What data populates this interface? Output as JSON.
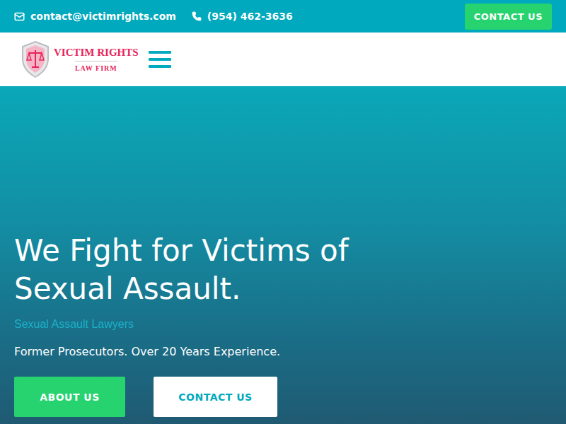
{
  "topbar": {
    "email": "contact@victimrights.com",
    "phone": "(954) 462-3636",
    "button": "CONTACT US"
  },
  "logo": {
    "name": "VICTIM RIGHTS",
    "subtitle": "LAW FIRM"
  },
  "hero": {
    "title": "We Fight for Victims of Sexual Assault.",
    "subtitle": "Sexual Assault Lawyers",
    "tagline": "Former Prosecutors. Over 20 Years Experience.",
    "buttons": [
      {
        "label": "ABOUT US",
        "kind": "primary"
      },
      {
        "label": "CONTACT US",
        "kind": "secondary"
      }
    ]
  }
}
